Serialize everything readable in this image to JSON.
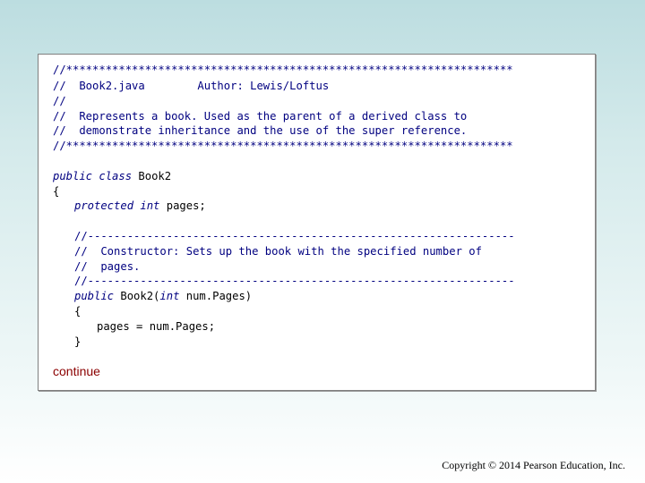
{
  "header_comment": {
    "border": "//********************************************************************",
    "filename_line": "//  Book2.java        Author: Lewis/Loftus",
    "blank": "//",
    "desc_line1": "//  Represents a book. Used as the parent of a derived class to",
    "desc_line2": "//  demonstrate inheritance and the use of the super reference."
  },
  "class_decl": {
    "keywords": "public class",
    "name": " Book2",
    "open_brace": "{",
    "field_keywords": "protected int",
    "field_rest": " pages;"
  },
  "constructor_comment": {
    "divider": "//-----------------------------------------------------------------",
    "line1": "//  Constructor: Sets up the book with the specified number of",
    "line2": "//  pages."
  },
  "constructor": {
    "kw_public": "public",
    "signature_mid": " Book2(",
    "kw_int": "int",
    "signature_end": " num.Pages)",
    "open_brace": "{",
    "body": "pages = num.Pages;",
    "close_brace": "}"
  },
  "continue_link": "continue",
  "copyright": "Copyright © 2014 Pearson Education, Inc.",
  "colors": {
    "comment": "#000080",
    "keyword": "#000080",
    "continue": "#8b0000",
    "background_top": "#bcdde0"
  }
}
